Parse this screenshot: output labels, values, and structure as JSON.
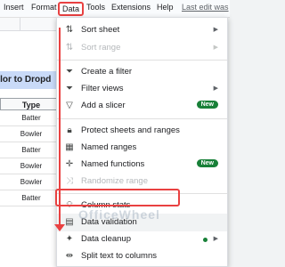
{
  "menubar": {
    "items": [
      "Insert",
      "Format",
      "Data",
      "Tools",
      "Extensions",
      "Help"
    ],
    "last_edit": "Last edit was"
  },
  "sheet": {
    "title": "olor to Dropd",
    "column_header": "Type",
    "rows": [
      "Batter",
      "Bowler",
      "Batter",
      "Bowler",
      "Bowler",
      "Batter"
    ]
  },
  "data_menu": {
    "sort_sheet": "Sort sheet",
    "sort_range": "Sort range",
    "create_filter": "Create a filter",
    "filter_views": "Filter views",
    "add_slicer": "Add a slicer",
    "new_badge": "New",
    "protect": "Protect sheets and ranges",
    "named_ranges": "Named ranges",
    "named_functions": "Named functions",
    "randomize_range": "Randomize range",
    "column_stats": "Column stats",
    "data_validation": "Data validation",
    "data_cleanup": "Data cleanup",
    "split_text": "Split text to columns"
  },
  "watermark": "OfficeWheel",
  "colors": {
    "accent_red": "#e94141",
    "new_badge": "#188038",
    "title_fill": "#c9daf8"
  }
}
